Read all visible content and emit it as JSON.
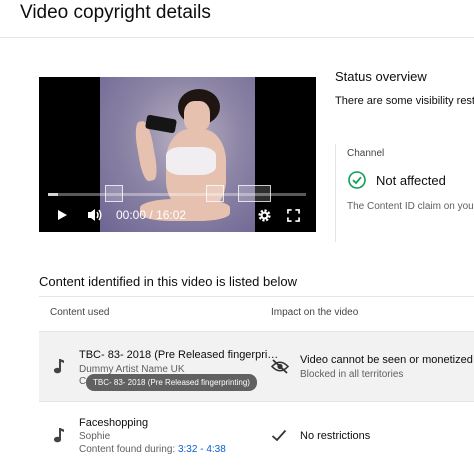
{
  "header": {
    "title": "Video copyright details"
  },
  "player": {
    "time_current": "00:00",
    "time_separator": "/",
    "time_total": "16:02",
    "progress_fraction": 0.04,
    "icons": [
      "play-icon",
      "volume-icon",
      "settings-icon",
      "fullscreen-icon"
    ]
  },
  "status": {
    "title": "Status overview",
    "text": "There are some visibility restri affected.",
    "channel_label": "Channel",
    "channel_status": "Not affected",
    "channel_note": "The Content ID claim on your video doesn't affec…"
  },
  "content": {
    "title": "Content identified in this video is listed below",
    "columns": [
      "Content used",
      "Impact on the video"
    ],
    "rows": [
      {
        "title": "TBC- 83- 2018 (Pre Released fingerpri…",
        "artist": "Dummy Artist Name UK",
        "found_prefix": "C",
        "impact": "Video cannot be seen or monetized",
        "impact_sub": "Blocked in all territories",
        "impact_icon": "eye-off-icon"
      },
      {
        "title": "Faceshopping",
        "artist": "Sophie",
        "found_prefix": "Content found during:",
        "found_range": "3:32 - 4:38",
        "impact": "No restrictions",
        "impact_icon": "check-icon"
      }
    ],
    "tooltip": "TBC- 83- 2018 (Pre Released fingerprinting)"
  },
  "colors": {
    "accent_green": "#0f9d58",
    "link_blue": "#065fd4",
    "row_highlight": "#f2f2f2"
  }
}
